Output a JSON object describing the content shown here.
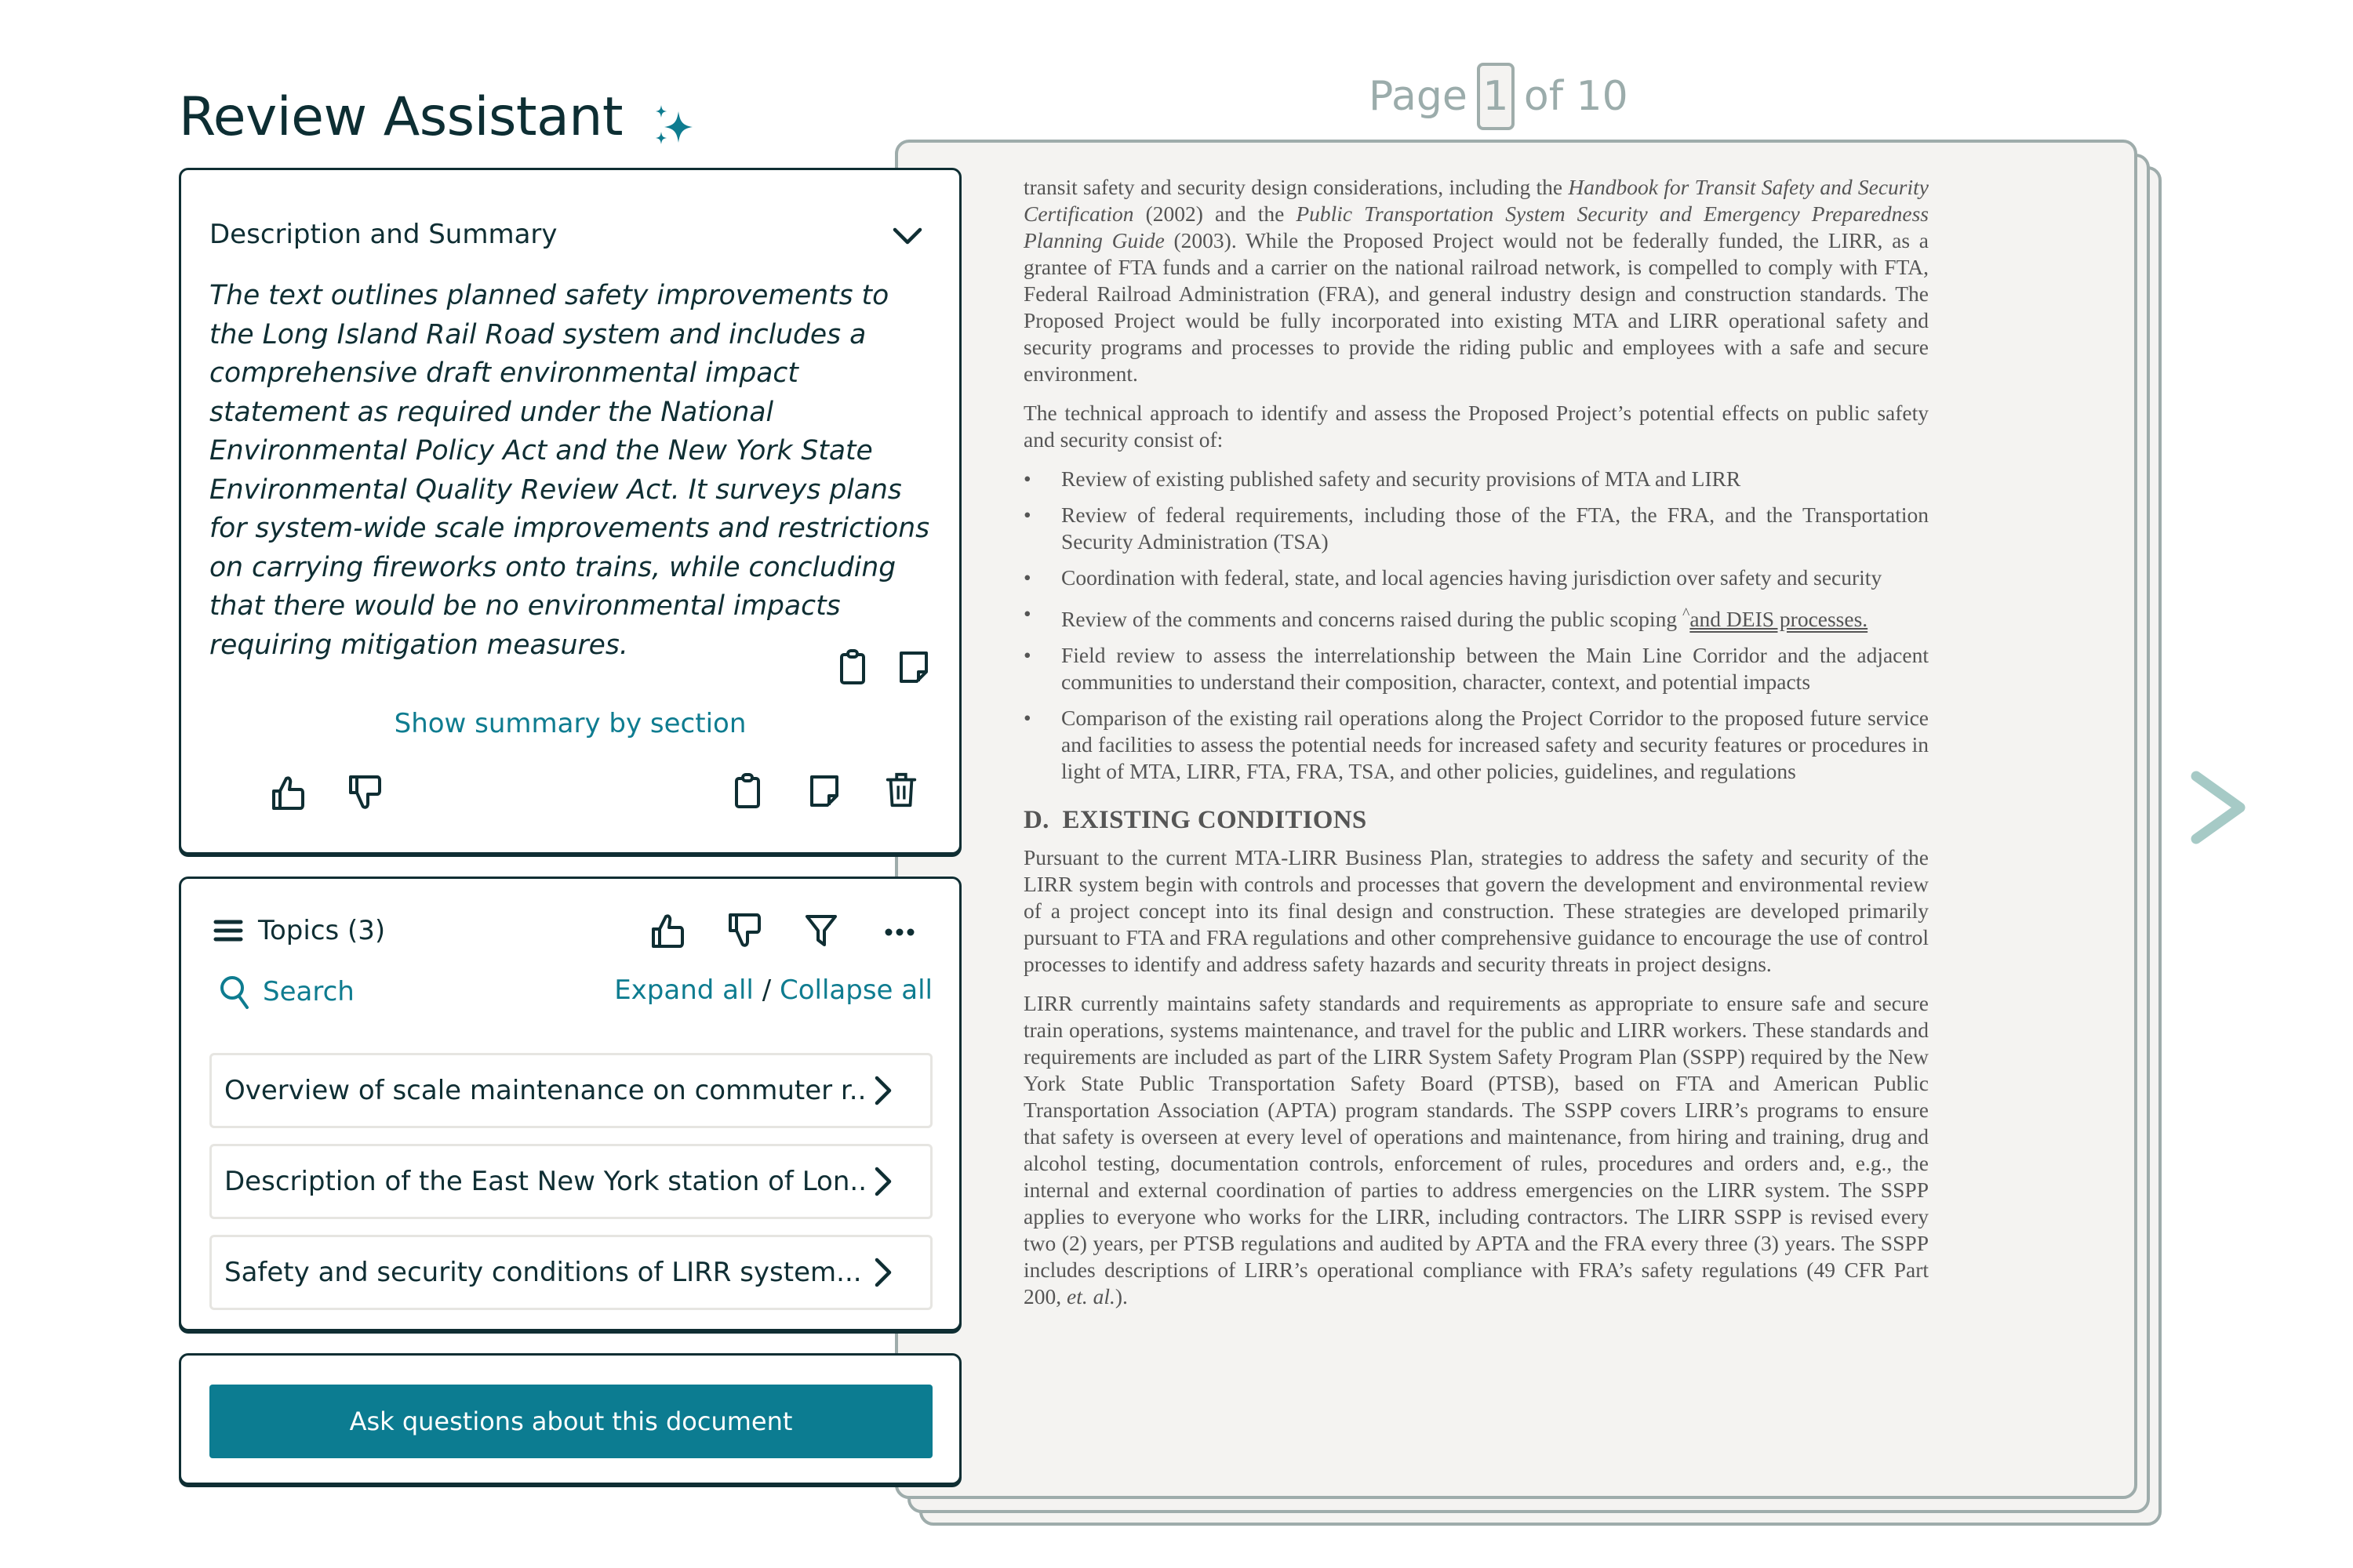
{
  "app": {
    "title": "Review Assistant",
    "title_icon": "sparkle-icon"
  },
  "colors": {
    "accent": "#0c7c91",
    "text_dark": "#0f2e33",
    "muted": "#9bacab",
    "page_bg": "#f4f3f1"
  },
  "summary_panel": {
    "header": "Description and Summary",
    "collapse_icon": "chevron-down-icon",
    "text": "The text outlines planned safety improvements to the Long Island Rail Road system and includes a comprehensive draft environmental impact statement as required under the National Environmental Policy Act and the New York State Environmental Quality Review Act. It surveys plans for system-wide scale improvements and restrictions on carrying fireworks onto trains, while concluding that there would be no environmental impacts requiring mitigation measures.",
    "inline_actions": [
      "clipboard-icon",
      "note-icon"
    ],
    "show_by_section_label": "Show summary by section",
    "footer_actions_left": [
      "thumbs-up-icon",
      "thumbs-down-icon"
    ],
    "footer_actions_right": [
      "clipboard-icon",
      "note-icon",
      "trash-icon"
    ]
  },
  "topics_panel": {
    "header": "Topics (3)",
    "header_icon": "hamburger-icon",
    "toolbar_icons": [
      "thumbs-up-icon",
      "thumbs-down-icon",
      "filter-icon",
      "more-icon"
    ],
    "search_label": "Search",
    "expand_all": "Expand all",
    "separator": "/",
    "collapse_all": "Collapse all",
    "items": [
      {
        "label": "Overview of scale maintenance on commuter r..."
      },
      {
        "label": "Description of the East New York station of Lon..."
      },
      {
        "label": "Safety and security conditions of LIRR system..."
      }
    ]
  },
  "ask_panel": {
    "button_label": "Ask questions about this document"
  },
  "pager": {
    "prefix": "Page",
    "current": "1",
    "suffix": "of 10",
    "next_icon": "chevron-right-icon"
  },
  "document": {
    "p1": {
      "a": "transit safety and security design considerations, including the ",
      "em1": "Handbook for Transit Safety and Security Certification",
      "b": " (2002) and the ",
      "em2": "Public Transportation System Security and Emergency Preparedness Planning Guide",
      "c": " (2003). While the Proposed Project would not be federally funded, the LIRR, as a grantee of FTA funds and a carrier on the national railroad network, is compelled to comply with FTA, Federal Railroad Administration (FRA), and general industry design and construction standards. The Proposed Project would be fully incorporated into existing MTA and LIRR operational safety and security programs and processes to provide the riding public and employees with a safe and secure environment."
    },
    "p2": "The technical approach to identify and assess the Proposed Project’s potential effects on public safety and security consist of:",
    "bullets": [
      "Review of existing published safety and security provisions of MTA and LIRR",
      "Review of federal requirements, including those of the FTA, the FRA, and the Transportation Security Administration (TSA)",
      "Coordination with federal, state, and local agencies having jurisdiction over safety and security",
      "Field review to assess the interrelationship between the Main Line Corridor and the adjacent communities to understand their composition, character, context, and potential impacts",
      "Comparison of the existing rail operations along the Project Corridor to the proposed future service and facilities to assess the potential needs for increased safety and security features or procedures in light of MTA, LIRR, FTA, FRA, TSA, and other policies, guidelines, and regulations"
    ],
    "bullet4": {
      "text": "Review of the comments and concerns raised during the public scoping ",
      "caret": "^",
      "inserted": "and DEIS processes."
    },
    "heading": "D. EXISTING CONDITIONS",
    "p3": "Pursuant to the current MTA-LIRR Business Plan, strategies to address the safety and security of the LIRR system begin with controls and processes that govern the development and environmental review of a project concept into its final design and construction. These strategies are developed primarily pursuant to FTA and FRA regulations and other comprehensive guidance to encourage the use of control processes to identify and address safety hazards and security threats in project designs.",
    "p4": {
      "a": "LIRR currently maintains safety standards and requirements as appropriate to ensure safe and secure train operations, systems maintenance, and travel for the public and LIRR workers. These standards and requirements are included as part of the LIRR System Safety Program Plan (SSPP) required by the New York State Public Transportation Safety Board (PTSB), based on FTA and American Public Transportation Association (APTA) program standards. The SSPP covers LIRR’s programs to ensure that safety is overseen at every level of operations and maintenance, from hiring and training, drug and alcohol testing, documentation controls, enforcement of rules, procedures and orders and, e.g., the internal and external coordination of parties to address emergencies on the LIRR system. The SSPP applies to everyone who works for the LIRR, including contractors. The LIRR SSPP is revised every two (2) years, per PTSB regulations and audited by APTA and the FRA every three (3) years. The SSPP includes descriptions of LIRR’s operational compliance with FRA’s safety regulations (49 CFR Part 200, ",
      "em": "et. al.",
      "b": ")."
    }
  }
}
